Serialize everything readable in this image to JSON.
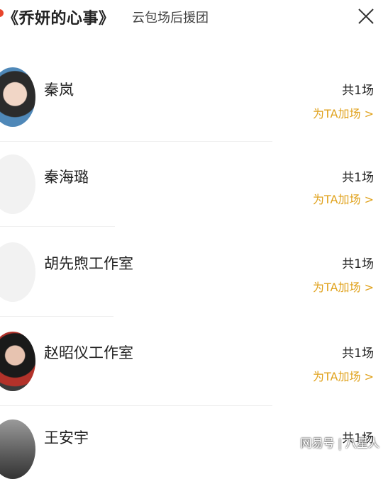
{
  "header": {
    "title": "《乔妍的心事》",
    "subtitle": "云包场后援团"
  },
  "rows": [
    {
      "name": "秦岚",
      "count": "共1场",
      "action": "为TA加场 >"
    },
    {
      "name": "秦海璐",
      "count": "共1场",
      "action": "为TA加场 >"
    },
    {
      "name": "胡先煦工作室",
      "count": "共1场",
      "action": "为TA加场 >"
    },
    {
      "name": "赵昭仪工作室",
      "count": "共1场",
      "action": "为TA加场 >"
    },
    {
      "name": "王安宇",
      "count": "共1场"
    }
  ],
  "watermark": "网易号 | 八星人"
}
